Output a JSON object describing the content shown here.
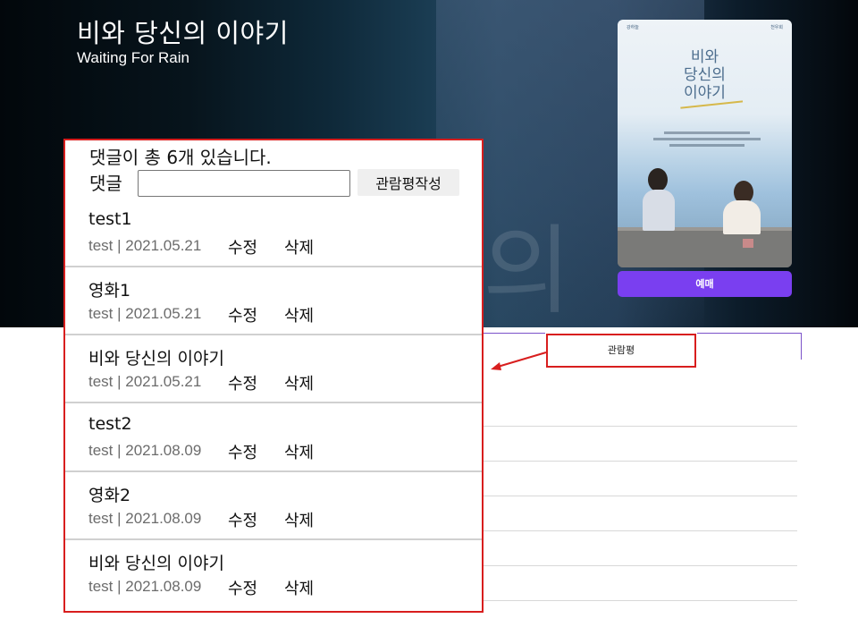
{
  "hero": {
    "title": "비와 당신의 이야기",
    "subtitle": "Waiting For Rain",
    "watermark": "의"
  },
  "poster": {
    "title_lines": [
      "비와",
      "당신의",
      "이야기"
    ],
    "credit_left": "강하늘",
    "credit_right": "천우희"
  },
  "reserve_button": {
    "label": "예매"
  },
  "tabs": {
    "review_label": "관람평"
  },
  "comments": {
    "count_text": "댓글이 총 6개 있습니다.",
    "input_label": "댓글",
    "input_value": "",
    "submit_label": "관람평작성",
    "items": [
      {
        "title": "test1",
        "meta": "test | 2021.05.21",
        "edit": "수정",
        "delete": "삭제"
      },
      {
        "title": "영화1",
        "meta": "test | 2021.05.21",
        "edit": "수정",
        "delete": "삭제"
      },
      {
        "title": "비와 당신의 이야기",
        "meta": "test | 2021.05.21",
        "edit": "수정",
        "delete": "삭제"
      },
      {
        "title": "test2",
        "meta": "test | 2021.08.09",
        "edit": "수정",
        "delete": "삭제"
      },
      {
        "title": "영화2",
        "meta": "test | 2021.08.09",
        "edit": "수정",
        "delete": "삭제"
      },
      {
        "title": "비와 당신의 이야기",
        "meta": "test | 2021.08.09",
        "edit": "수정",
        "delete": "삭제"
      }
    ]
  },
  "colors": {
    "accent_purple": "#7a3ff0",
    "highlight_red": "#d81e1e"
  }
}
